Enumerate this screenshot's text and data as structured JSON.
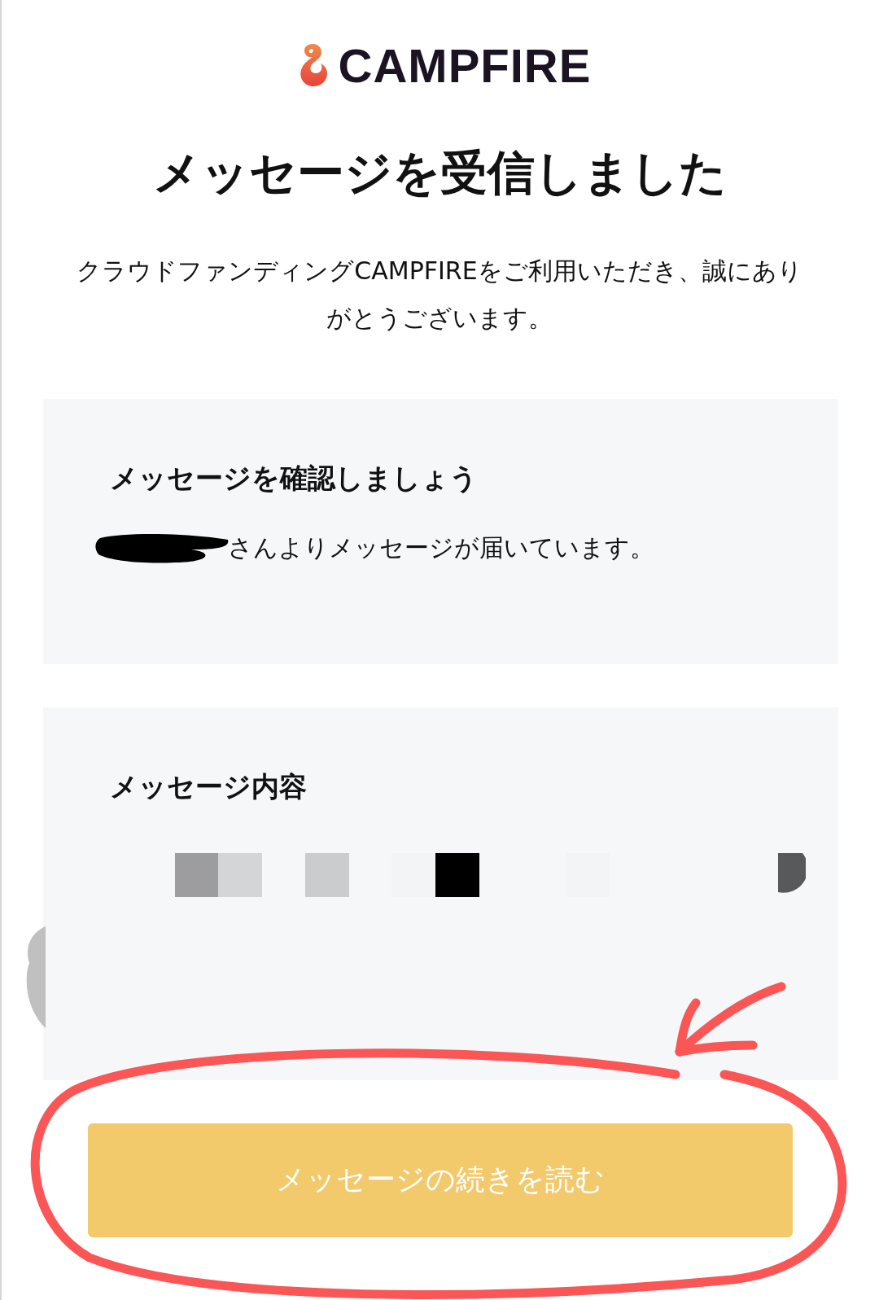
{
  "logo": {
    "text": "CAMPFIRE"
  },
  "title": "メッセージを受信しました",
  "intro": "クラウドファンディングCAMPFIREをご利用いただき、誠にありがとうございます。",
  "notice_card": {
    "heading": "メッセージを確認しましょう",
    "text": "さんよりメッセージが届いています。",
    "sender_redacted": true
  },
  "content_card": {
    "heading": "メッセージ内容"
  },
  "button": {
    "label": "メッセージの続きを読む"
  }
}
